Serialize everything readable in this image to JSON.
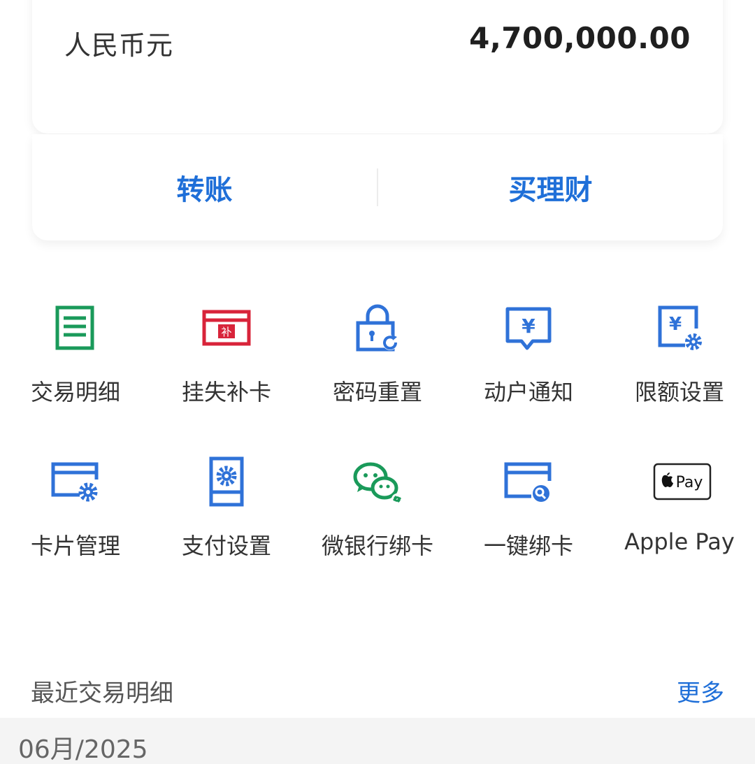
{
  "balance": {
    "currency": "人民币元",
    "amount": "4,700,000.00"
  },
  "actions": {
    "transfer": "转账",
    "buy_wealth": "买理财"
  },
  "services": [
    {
      "label": "交易明细",
      "icon": "list-document-icon",
      "color": "#1a9a5a"
    },
    {
      "label": "挂失补卡",
      "icon": "card-replace-icon",
      "color": "#d8243a"
    },
    {
      "label": "密码重置",
      "icon": "lock-reset-icon",
      "color": "#2f72d8"
    },
    {
      "label": "动户通知",
      "icon": "yuan-message-icon",
      "color": "#2f72d8"
    },
    {
      "label": "限额设置",
      "icon": "yuan-gear-icon",
      "color": "#2f72d8"
    },
    {
      "label": "卡片管理",
      "icon": "card-gear-icon",
      "color": "#2f72d8"
    },
    {
      "label": "支付设置",
      "icon": "payment-settings-icon",
      "color": "#2f72d8"
    },
    {
      "label": "微银行绑卡",
      "icon": "wechat-link-icon",
      "color": "#1a9a5a"
    },
    {
      "label": "一键绑卡",
      "icon": "card-quick-bind-icon",
      "color": "#2f72d8"
    },
    {
      "label": "Apple Pay",
      "icon": "apple-pay-icon",
      "color": "#111111"
    }
  ],
  "apple_pay_badge": "Pay",
  "recent": {
    "title": "最近交易明细",
    "more": "更多",
    "month": "06月/2025"
  }
}
